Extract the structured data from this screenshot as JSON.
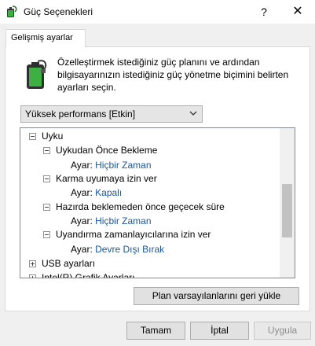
{
  "window": {
    "title": "Güç Seçenekleri",
    "help_glyph": "?",
    "close_glyph": "✕",
    "icon": "power-options-icon"
  },
  "tabs": [
    {
      "label": "Gelişmiş ayarlar",
      "selected": true
    }
  ],
  "description": "Özelleştirmek istediğiniz güç planını ve ardından bilgisayarınızın istediğiniz güç yönetme biçimini belirten ayarları seçin.",
  "plan_select": {
    "selected": "Yüksek performans [Etkin]"
  },
  "tree": {
    "setting_label": "Ayar:",
    "items": [
      {
        "label": "Uyku",
        "expanded": true
      },
      {
        "label": "Uykudan Önce Bekleme",
        "expanded": true,
        "value": "Hiçbir Zaman"
      },
      {
        "label": "Karma uyumaya izin ver",
        "expanded": true,
        "value": "Kapalı"
      },
      {
        "label": "Hazırda beklemeden önce geçecek süre",
        "expanded": true,
        "value": "Hiçbir Zaman"
      },
      {
        "label": "Uyandırma zamanlayıcılarına izin ver",
        "expanded": true,
        "value": "Devre Dışı Bırak"
      },
      {
        "label": "USB ayarları",
        "expanded": false
      },
      {
        "label": "Intel(R) Grafik Ayarları",
        "expanded": false
      }
    ]
  },
  "buttons": {
    "restore_defaults": "Plan varsayılanlarını geri yükle",
    "ok": "Tamam",
    "cancel": "İptal",
    "apply": "Uygula"
  },
  "colors": {
    "value_text": "#1a56b0",
    "battery_green": "#3cb043"
  }
}
